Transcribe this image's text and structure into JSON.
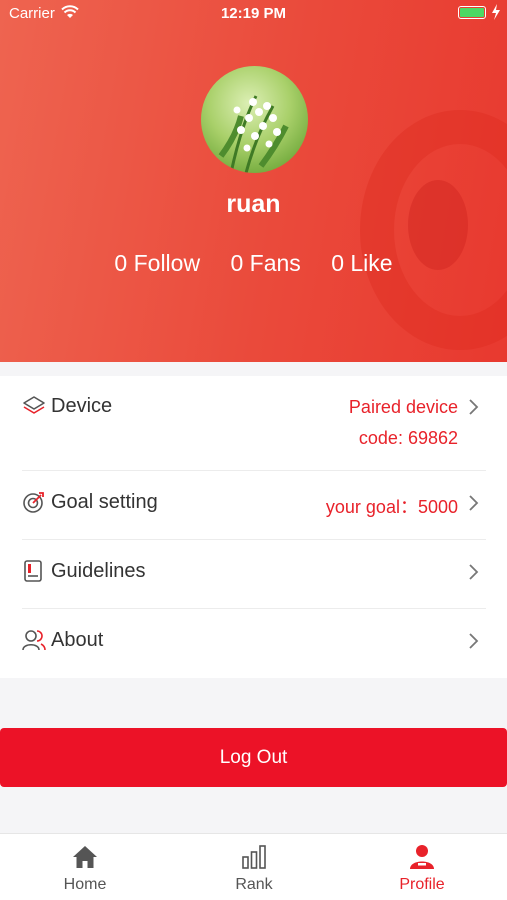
{
  "status_bar": {
    "carrier": "Carrier",
    "time": "12:19 PM"
  },
  "profile": {
    "username": "ruan",
    "stats": [
      "0 Follow",
      "0 Fans",
      "0 Like"
    ]
  },
  "menu": {
    "device": {
      "label": "Device",
      "value_line1": "Paired device",
      "value_line2": "code: 69862"
    },
    "goal": {
      "label": "Goal setting",
      "value": "your goal：5000"
    },
    "guidelines": {
      "label": "Guidelines"
    },
    "about": {
      "label": "About"
    }
  },
  "logout_label": "Log Out",
  "tabs": [
    {
      "label": "Home",
      "icon": "home-icon"
    },
    {
      "label": "Rank",
      "icon": "bar-chart-icon"
    },
    {
      "label": "Profile",
      "icon": "user-icon"
    }
  ],
  "colors": {
    "accent": "#e8222a",
    "header": "#ea4a3b",
    "logout": "#ec1227"
  }
}
